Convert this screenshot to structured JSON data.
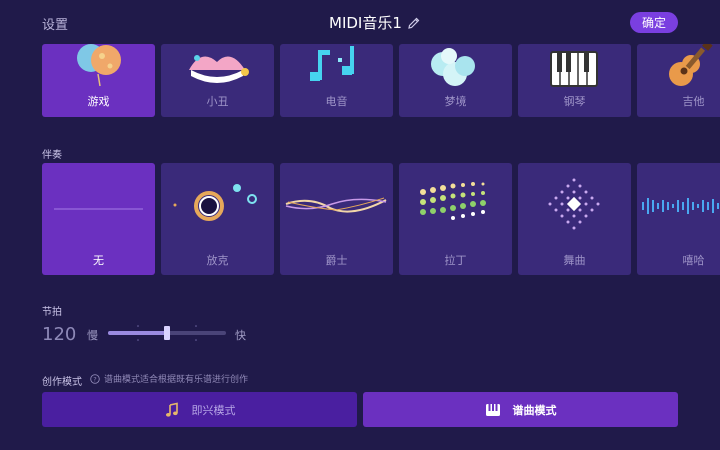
{
  "header": {
    "settings_label": "设置",
    "title": "MIDI音乐1",
    "confirm_label": "确定"
  },
  "instruments": [
    {
      "label": "游戏",
      "icon": "balloon-icon",
      "selected": true
    },
    {
      "label": "小丑",
      "icon": "jester-hat-icon",
      "selected": false
    },
    {
      "label": "电音",
      "icon": "music-notes-icon",
      "selected": false
    },
    {
      "label": "梦境",
      "icon": "cloud-icon",
      "selected": false
    },
    {
      "label": "钢琴",
      "icon": "piano-keys-icon",
      "selected": false
    },
    {
      "label": "吉他",
      "icon": "guitar-icon",
      "selected": false
    }
  ],
  "accompaniment": {
    "section_label": "伴奏",
    "items": [
      {
        "label": "无",
        "selected": true
      },
      {
        "label": "放克",
        "selected": false
      },
      {
        "label": "爵士",
        "selected": false
      },
      {
        "label": "拉丁",
        "selected": false
      },
      {
        "label": "舞曲",
        "selected": false
      },
      {
        "label": "嘻哈",
        "selected": false
      }
    ]
  },
  "tempo": {
    "section_label": "节拍",
    "value": "120",
    "slow_label": "慢",
    "fast_label": "快",
    "level_fraction": 0.5
  },
  "creation_mode": {
    "section_label": "创作模式",
    "hint": "谱曲模式适合根据既有乐谱进行创作",
    "free_label": "即兴模式",
    "score_label": "谱曲模式",
    "selected": "score"
  },
  "colors": {
    "background": "#201a4a",
    "card": "#3a2a7a",
    "selected": "#6b30c0",
    "accent": "#7a3fe0"
  }
}
